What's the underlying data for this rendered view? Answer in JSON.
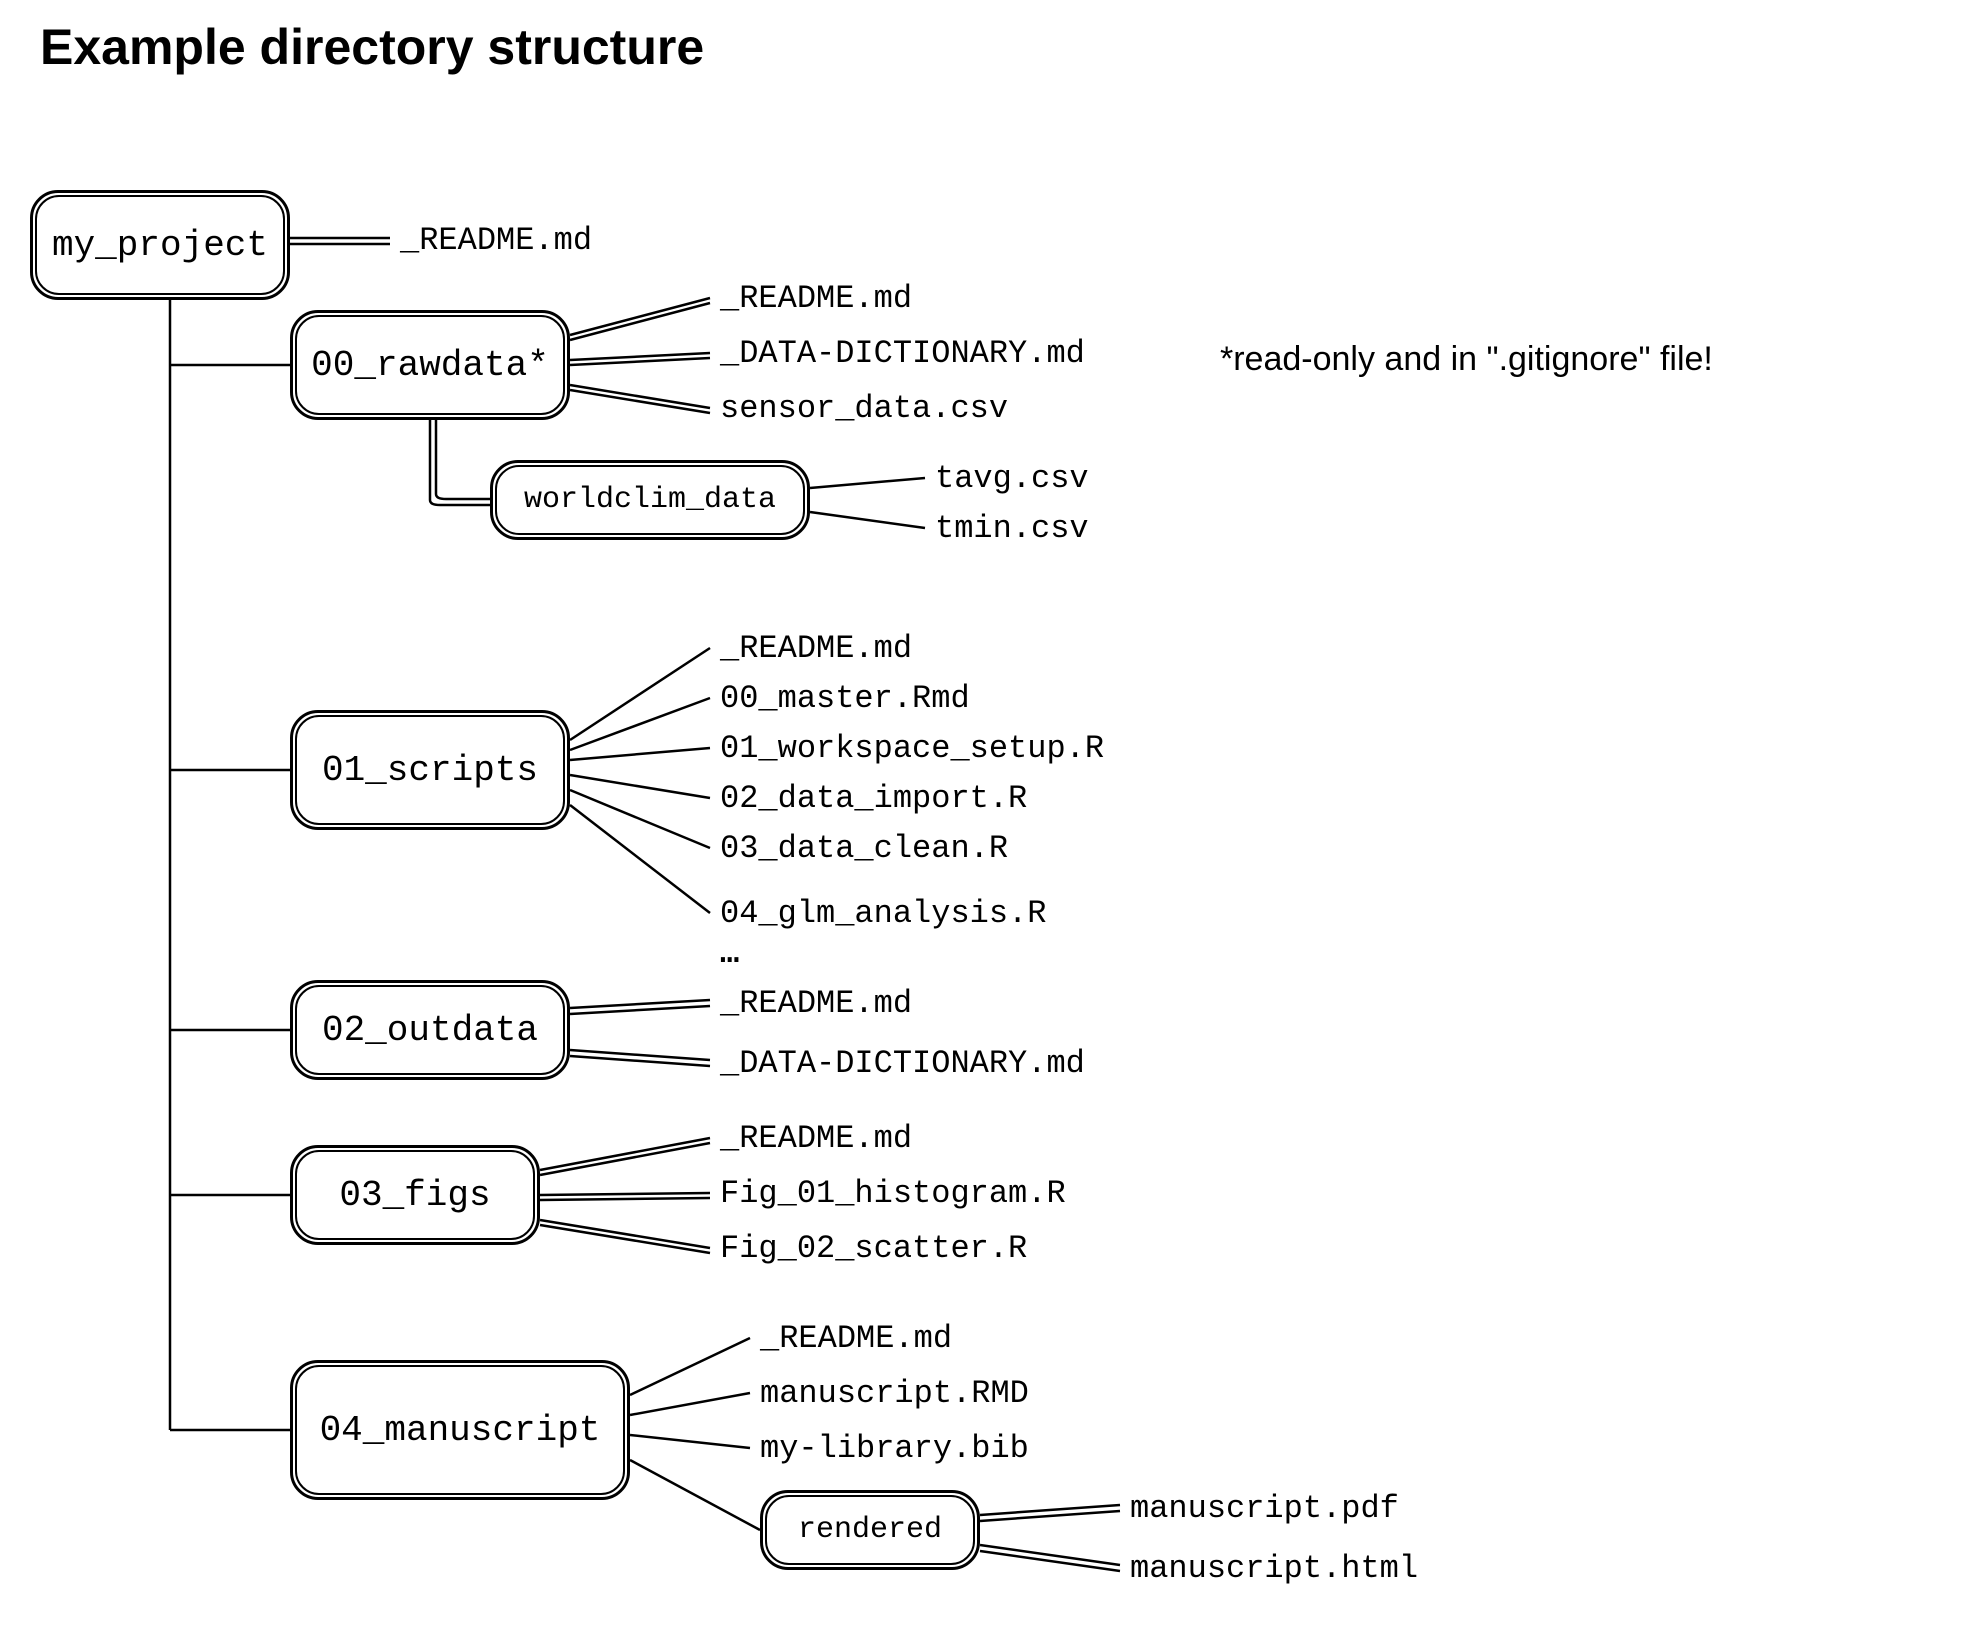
{
  "title": "Example directory structure",
  "annotation": "*read-only and in \".gitignore\" file!",
  "root": {
    "label": "my_project",
    "files": [
      "_README.md"
    ]
  },
  "dirs": [
    {
      "label": "00_rawdata*",
      "files": [
        "_README.md",
        "_DATA-DICTIONARY.md",
        "sensor_data.csv"
      ],
      "subdir": {
        "label": "worldclim_data",
        "files": [
          "tavg.csv",
          "tmin.csv"
        ]
      }
    },
    {
      "label": "01_scripts",
      "files": [
        "_README.md",
        "00_master.Rmd",
        "01_workspace_setup.R",
        "02_data_import.R",
        "03_data_clean.R",
        "04_glm_analysis.R",
        "…"
      ]
    },
    {
      "label": "02_outdata",
      "files": [
        "_README.md",
        "_DATA-DICTIONARY.md"
      ]
    },
    {
      "label": "03_figs",
      "files": [
        "_README.md",
        "Fig_01_histogram.R",
        "Fig_02_scatter.R"
      ]
    },
    {
      "label": "04_manuscript",
      "files": [
        "_README.md",
        "manuscript.RMD",
        "my-library.bib"
      ],
      "subdir": {
        "label": "rendered",
        "files": [
          "manuscript.pdf",
          "manuscript.html"
        ]
      }
    }
  ]
}
